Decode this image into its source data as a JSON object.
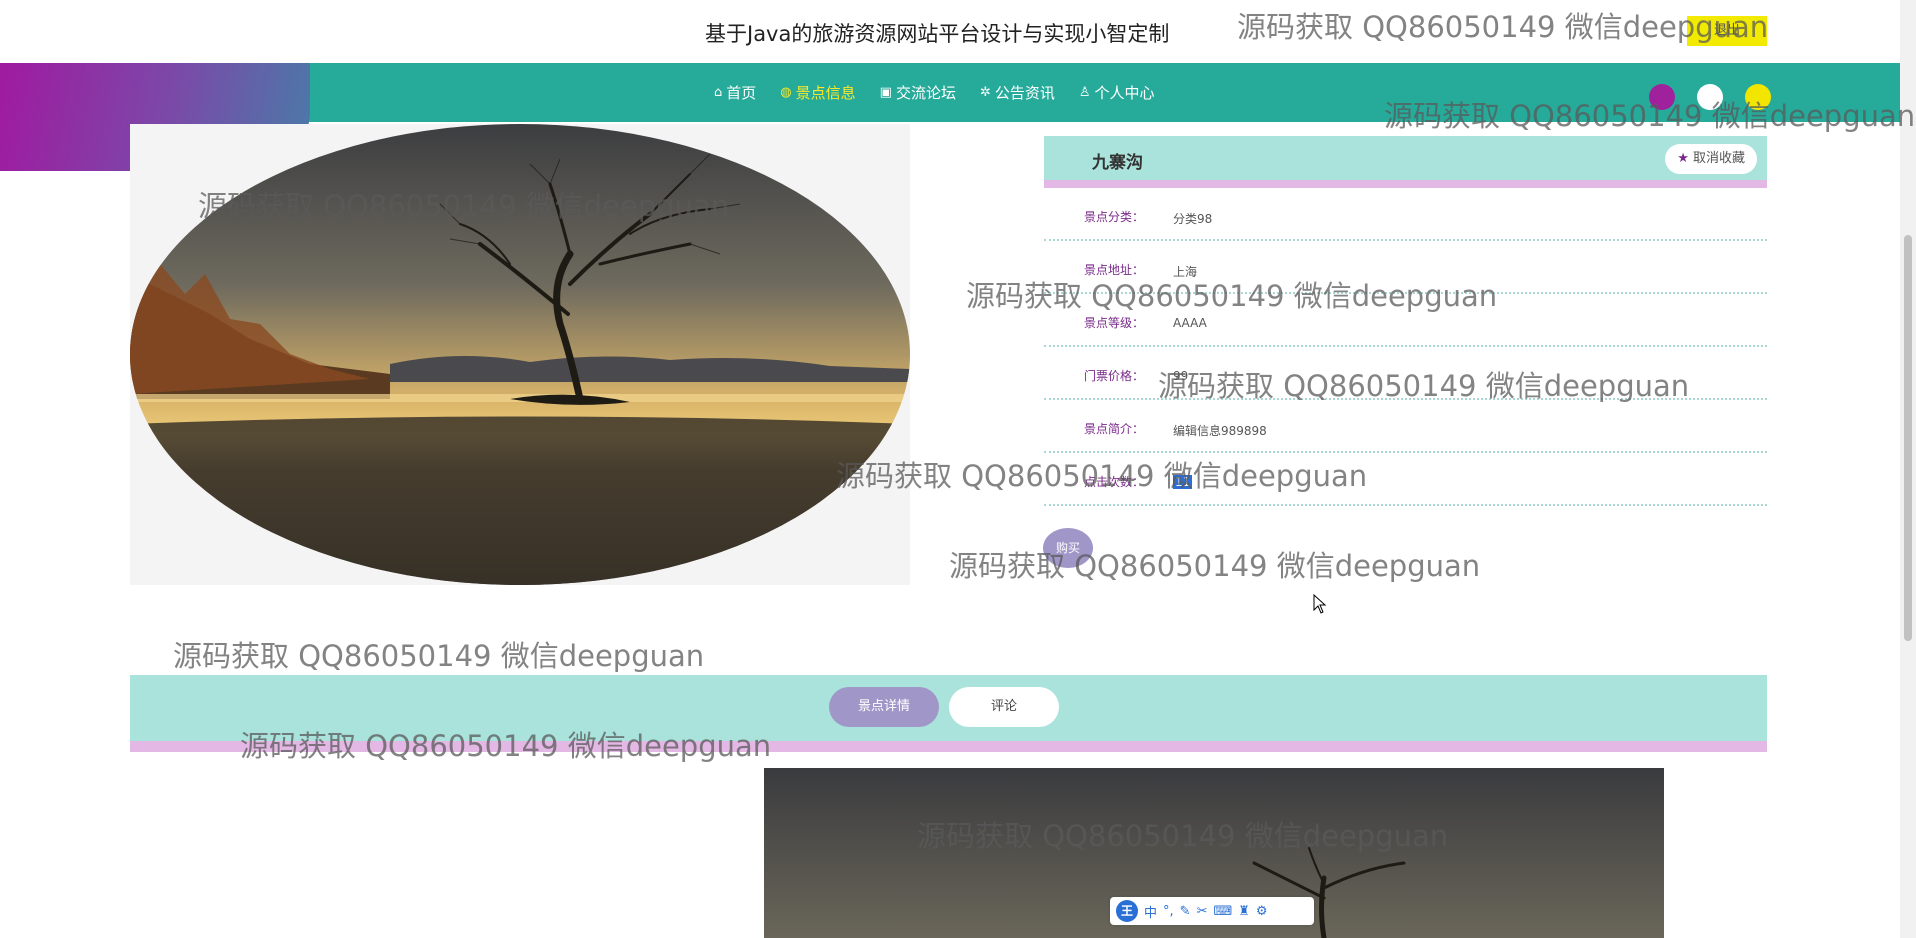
{
  "header": {
    "site_title": "基于Java的旅游资源网站平台设计与实现小智定制",
    "logout_label": "退出"
  },
  "nav": {
    "items": [
      {
        "label": "首页",
        "icon": "home-icon",
        "glyph": "⌂"
      },
      {
        "label": "景点信息",
        "icon": "globe-icon",
        "glyph": "◍"
      },
      {
        "label": "交流论坛",
        "icon": "gift-icon",
        "glyph": "▣"
      },
      {
        "label": "公告资讯",
        "icon": "gear-icon",
        "glyph": "✲"
      },
      {
        "label": "个人中心",
        "icon": "user-icon",
        "glyph": "♙"
      }
    ],
    "active_index": 1,
    "theme_dots": [
      "#a0219c",
      "#ffffff",
      "#f2e600"
    ]
  },
  "spot": {
    "name": "九寨沟",
    "unfavorite_label": "取消收藏",
    "fields": [
      {
        "label": "景点分类：",
        "value": "分类98"
      },
      {
        "label": "景点地址：",
        "value": "上海"
      },
      {
        "label": "景点等级：",
        "value": "AAAA"
      },
      {
        "label": "门票价格：",
        "value": "99"
      },
      {
        "label": "景点简介：",
        "value": "编辑信息989898"
      },
      {
        "label": "点击次数：",
        "value": "11"
      }
    ],
    "buy_label": "购买"
  },
  "tabs": {
    "detail_label": "景点详情",
    "comment_label": "评论"
  },
  "ime_toolbar": {
    "logo": "王",
    "mode": "中"
  },
  "watermark_text": "源码获取 QQ86050149 微信deepguan",
  "colors": {
    "nav_bg": "#26ab9b",
    "accent_purple": "#7a2a8a",
    "panel_teal": "#a9e3dc",
    "active_nav": "#f8ea2a",
    "logout_yellow": "#f2ea00"
  }
}
